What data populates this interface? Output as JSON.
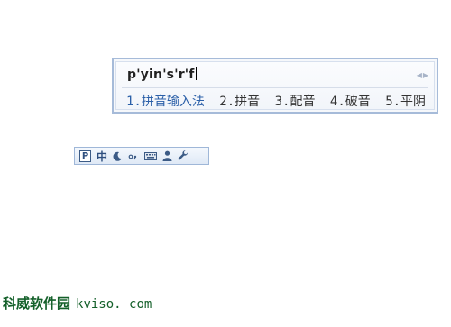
{
  "ime": {
    "composition": "p'yin's'r'f",
    "pager": {
      "prev_icon": "triangle-left",
      "next_icon": "triangle-right"
    },
    "candidates": [
      {
        "label": "1.拼音输入法"
      },
      {
        "label": "2.拼音"
      },
      {
        "label": "3.配音"
      },
      {
        "label": "4.破音"
      },
      {
        "label": "5.平阴"
      }
    ],
    "colors": {
      "border": "#a6bbd9",
      "highlight": "#2a5fa8",
      "status_icon": "#3c5b86"
    }
  },
  "status_bar": {
    "logo": "P",
    "mode": "中",
    "icons": [
      "moon-icon",
      "punctuation-icon",
      "keyboard-icon",
      "user-icon",
      "wrench-icon"
    ]
  },
  "watermark": {
    "cn": "科威软件园",
    "url": "kviso. com",
    "color": "#14602a"
  }
}
